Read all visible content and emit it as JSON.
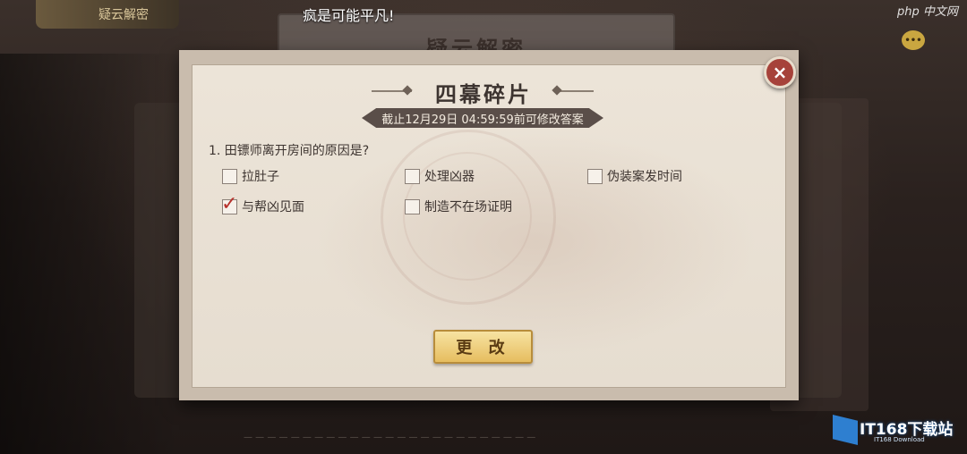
{
  "marquee": "疯是可能平凡!",
  "background": {
    "title_plaque": "疑云解密",
    "top_badge": "疑云解密"
  },
  "dialog": {
    "title": "四幕碎片",
    "deadline": "截止12月29日 04:59:59前可修改答案",
    "question": "1. 田镖师离开房间的原因是?",
    "options": [
      {
        "label": "拉肚子",
        "checked": false
      },
      {
        "label": "处理凶器",
        "checked": false
      },
      {
        "label": "伪装案发时间",
        "checked": false
      },
      {
        "label": "与帮凶见面",
        "checked": true
      },
      {
        "label": "制造不在场证明",
        "checked": false
      }
    ],
    "change_button": "更 改",
    "close_icon": "×"
  },
  "watermark": {
    "brand": "IT168下载站",
    "sub": "IT168 Download"
  },
  "php_badge": "php 中文网",
  "colors": {
    "dialog_paper": "#ece4d8",
    "button_gold": "#e6bd5f",
    "close_red": "#a6423a",
    "check_red": "#b7312b",
    "deadline_banner": "#5a4e49"
  }
}
